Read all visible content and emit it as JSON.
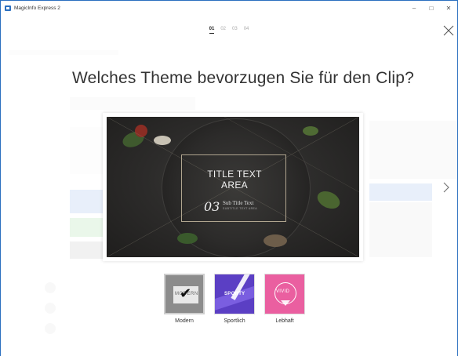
{
  "window": {
    "title": "MagicInfo Express 2",
    "minimize_glyph": "–",
    "maximize_glyph": "□",
    "close_glyph": "✕"
  },
  "steps": [
    "01",
    "02",
    "03",
    "04"
  ],
  "active_step": "01",
  "heading": "Welches Theme bevorzugen Sie für den Clip?",
  "preview": {
    "title_text": "TITLE TEXT\nAREA",
    "number": "03",
    "subtitle": "Sub Title Text",
    "subtitle_small": "SUBTITLE TEXT AREA"
  },
  "themes": [
    {
      "label": "Modern",
      "thumb_word": "MODERN",
      "selected": true,
      "color": "#8c8c8c"
    },
    {
      "label": "Sportlich",
      "thumb_word": "SPORTY",
      "selected": false,
      "color": "#5b3fc4"
    },
    {
      "label": "Lebhaft",
      "thumb_word": "VIVID",
      "selected": false,
      "color": "#ea5fa0"
    }
  ],
  "icons": {
    "close": "close-icon",
    "next": "chevron-right-icon",
    "check": "checkmark-icon"
  },
  "colors": {
    "accent": "#2b6fbf"
  }
}
